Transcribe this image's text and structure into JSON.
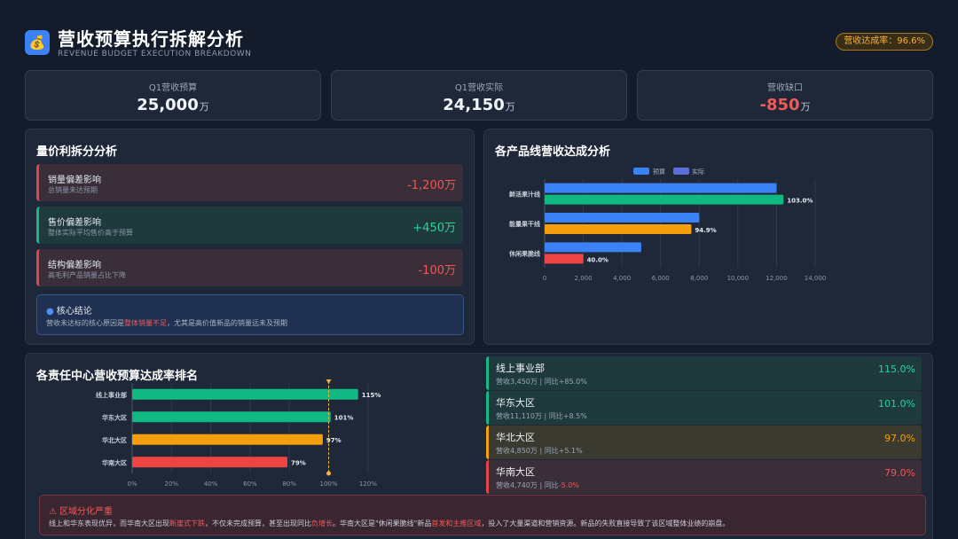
{
  "header": {
    "logo_icon": "money-bag-icon",
    "title": "营收预算执行拆解分析",
    "subtitle": "REVENUE BUDGET EXECUTION BREAKDOWN",
    "rate_badge": "营收达成率：96.6%"
  },
  "kpis": [
    {
      "label": "Q1营收预算",
      "value": "25,000",
      "unit": "万"
    },
    {
      "label": "Q1营收实际",
      "value": "24,150",
      "unit": "万"
    },
    {
      "label": "营收缺口",
      "value": "-850",
      "unit": "万"
    }
  ],
  "variance": {
    "title": "量价利拆分分析",
    "rows": [
      {
        "name": "销量偏差影响",
        "desc": "总销量未达预期",
        "value": "-1,200万",
        "tone": "red"
      },
      {
        "name": "售价偏差影响",
        "desc": "整体实际平均售价高于预算",
        "value": "+450万",
        "tone": "green"
      },
      {
        "name": "结构偏差影响",
        "desc": "高毛利产品销量占比下降",
        "value": "-100万",
        "tone": "red"
      }
    ],
    "conclusion": {
      "icon": "pin-icon",
      "title": "核心结论",
      "text_before": "营收未达标的核心原因是",
      "highlight": "整体销量不足",
      "text_after": "，尤其是高价值新品的销量远未及预期"
    }
  },
  "product_chart": {
    "title": "各产品线营收达成分析",
    "legend": [
      "预算",
      "实际"
    ],
    "colors": {
      "budget": "#3b82f6",
      "actual_good": "#10b981",
      "actual_mid": "#f59e0b",
      "actual_bad": "#ef4444"
    }
  },
  "center_chart": {
    "title": "各责任中心营收预算达成率排名",
    "marker_label": "~~~"
  },
  "chart_data": [
    {
      "type": "bar",
      "orientation": "horizontal",
      "categories": [
        "鲜活果汁线",
        "能量果干线",
        "休闲果脆线"
      ],
      "series": [
        {
          "name": "预算",
          "values": [
            12000,
            8000,
            5000
          ]
        },
        {
          "name": "实际",
          "values": [
            12360,
            7592,
            2000
          ]
        }
      ],
      "data_labels": [
        "103.0%",
        "94.9%",
        "40.0%"
      ],
      "xlim": [
        0,
        14000
      ],
      "xticks": [
        "0",
        "2,000",
        "4,000",
        "6,000",
        "8,000",
        "10,000",
        "12,000",
        "14,000"
      ],
      "legend": "top"
    },
    {
      "type": "bar",
      "orientation": "horizontal",
      "categories": [
        "线上事业部",
        "华东大区",
        "华北大区",
        "华南大区"
      ],
      "values": [
        115,
        101,
        97,
        79
      ],
      "data_labels": [
        "115%",
        "101%",
        "97%",
        "79%"
      ],
      "xlim": [
        0,
        130
      ],
      "xticks": [
        "0%",
        "20%",
        "40%",
        "60%",
        "80%",
        "100%",
        "120%"
      ],
      "reference_line": 100
    }
  ],
  "centers": [
    {
      "name": "线上事业部",
      "rate": "115.0%",
      "revenue": "营收3,450万",
      "sep": " | ",
      "yoy_prefix": "同比",
      "yoy": "+85.0%",
      "tone": "g"
    },
    {
      "name": "华东大区",
      "rate": "101.0%",
      "revenue": "营收11,110万",
      "sep": " | ",
      "yoy_prefix": "同比",
      "yoy": "+8.5%",
      "tone": "g"
    },
    {
      "name": "华北大区",
      "rate": "97.0%",
      "revenue": "营收4,850万",
      "sep": " | ",
      "yoy_prefix": "同比",
      "yoy": "+5.1%",
      "tone": "o"
    },
    {
      "name": "华南大区",
      "rate": "79.0%",
      "revenue": "营收4,740万",
      "sep": " | ",
      "yoy_prefix": "同比",
      "yoy": "-5.0%",
      "tone": "r"
    }
  ],
  "alert": {
    "icon": "warning-icon",
    "title": "区域分化严重",
    "p1": "线上和华东表现优异，而华南大区出现",
    "h1": "断崖式下跌",
    "p2": "，不仅未完成预算，甚至出现同比",
    "h2": "负增长",
    "p3": "。华南大区是\"休闲果脆线\"新品",
    "h3": "首发和主推区域",
    "p4": "，投入了大量渠道和营销资源。新品的失败直接导致了该区域整体业绩的崩盘。"
  }
}
